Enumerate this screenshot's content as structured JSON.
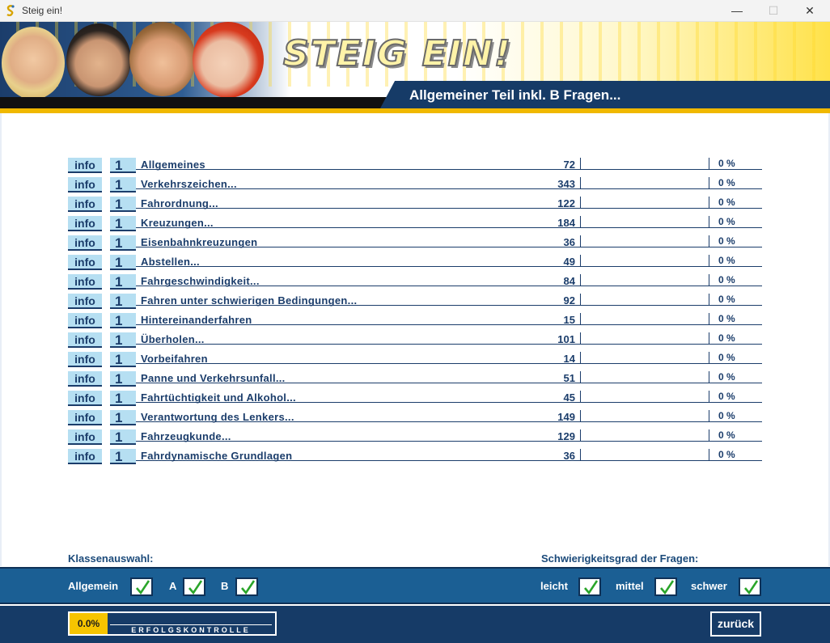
{
  "window": {
    "title": "Steig ein!"
  },
  "header": {
    "logo_text": "STEIG EIN!",
    "title": "Allgemeiner Teil inkl. B Fragen..."
  },
  "topics": [
    {
      "info": "info",
      "level": "1",
      "label": "Allgemeines",
      "count": "72",
      "percent": "0 %"
    },
    {
      "info": "info",
      "level": "1",
      "label": "Verkehrszeichen...",
      "count": "343",
      "percent": "0 %"
    },
    {
      "info": "info",
      "level": "1",
      "label": "Fahrordnung...",
      "count": "122",
      "percent": "0 %"
    },
    {
      "info": "info",
      "level": "1",
      "label": "Kreuzungen...",
      "count": "184",
      "percent": "0 %"
    },
    {
      "info": "info",
      "level": "1",
      "label": "Eisenbahnkreuzungen",
      "count": "36",
      "percent": "0 %"
    },
    {
      "info": "info",
      "level": "1",
      "label": "Abstellen...",
      "count": "49",
      "percent": "0 %"
    },
    {
      "info": "info",
      "level": "1",
      "label": "Fahrgeschwindigkeit...",
      "count": "84",
      "percent": "0 %"
    },
    {
      "info": "info",
      "level": "1",
      "label": "Fahren unter schwierigen Bedingungen...",
      "count": "92",
      "percent": "0 %"
    },
    {
      "info": "info",
      "level": "1",
      "label": "Hintereinanderfahren",
      "count": "15",
      "percent": "0 %"
    },
    {
      "info": "info",
      "level": "1",
      "label": "Überholen...",
      "count": "101",
      "percent": "0 %"
    },
    {
      "info": "info",
      "level": "1",
      "label": "Vorbeifahren",
      "count": "14",
      "percent": "0 %"
    },
    {
      "info": "info",
      "level": "1",
      "label": "Panne und Verkehrsunfall...",
      "count": "51",
      "percent": "0 %"
    },
    {
      "info": "info",
      "level": "1",
      "label": "Fahrtüchtigkeit und Alkohol...",
      "count": "45",
      "percent": "0 %"
    },
    {
      "info": "info",
      "level": "1",
      "label": "Verantwortung des Lenkers...",
      "count": "149",
      "percent": "0 %"
    },
    {
      "info": "info",
      "level": "1",
      "label": "Fahrzeugkunde...",
      "count": "129",
      "percent": "0 %"
    },
    {
      "info": "info",
      "level": "1",
      "label": "Fahrdynamische Grundlagen",
      "count": "36",
      "percent": "0 %"
    }
  ],
  "class_selection": {
    "heading": "Klassenauswahl:",
    "options": [
      {
        "label": "Allgemein",
        "checked": true
      },
      {
        "label": "A",
        "checked": true
      },
      {
        "label": "B",
        "checked": true
      }
    ]
  },
  "difficulty": {
    "heading": "Schwierigkeitsgrad der Fragen:",
    "options": [
      {
        "label": "leicht",
        "checked": true
      },
      {
        "label": "mittel",
        "checked": true
      },
      {
        "label": "schwer",
        "checked": true
      }
    ]
  },
  "footer": {
    "progress_value": "0.0%",
    "progress_label": "ERFOLGSKONTROLLE",
    "back_label": "zurück"
  },
  "colors": {
    "navy": "#163b67",
    "accent_blue": "#1b5f94",
    "light_blue_button": "#b6dff2",
    "gold": "#f6c400",
    "check_green": "#2aa52a"
  }
}
